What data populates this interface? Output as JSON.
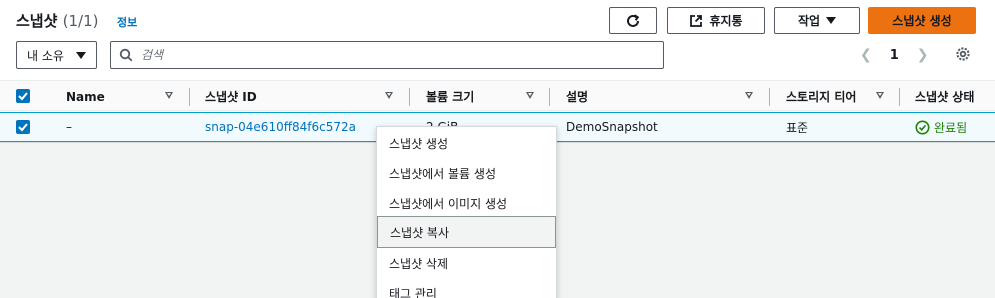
{
  "header": {
    "title": "스냅샷",
    "count": "(1/1)",
    "info_link": "정보"
  },
  "toolbar": {
    "recycle_label": "휴지통",
    "actions_label": "작업",
    "create_label": "스냅샷 생성"
  },
  "filters": {
    "owner_value": "내 소유",
    "search_placeholder": "검색"
  },
  "pagination": {
    "current_page": "1"
  },
  "table": {
    "columns": [
      "Name",
      "스냅샷 ID",
      "볼륨 크기",
      "설명",
      "스토리지 티어",
      "스냅샷 상태"
    ],
    "rows": [
      {
        "name": "–",
        "snapshot_id": "snap-04e610ff84f6c572a",
        "volume_size": "2 GiB",
        "description": "DemoSnapshot",
        "storage_tier": "표준",
        "status": "완료됨"
      }
    ]
  },
  "actions_menu": {
    "items": [
      "스냅샷 생성",
      "스냅샷에서 볼륨 생성",
      "스냅샷에서 이미지 생성",
      "스냅샷 복사",
      "스냅샷 삭제",
      "태그 관리"
    ]
  },
  "colors": {
    "primary": "#ec7211",
    "link": "#0073bb",
    "success": "#1d8102",
    "selected_row_bg": "#f1faff"
  }
}
